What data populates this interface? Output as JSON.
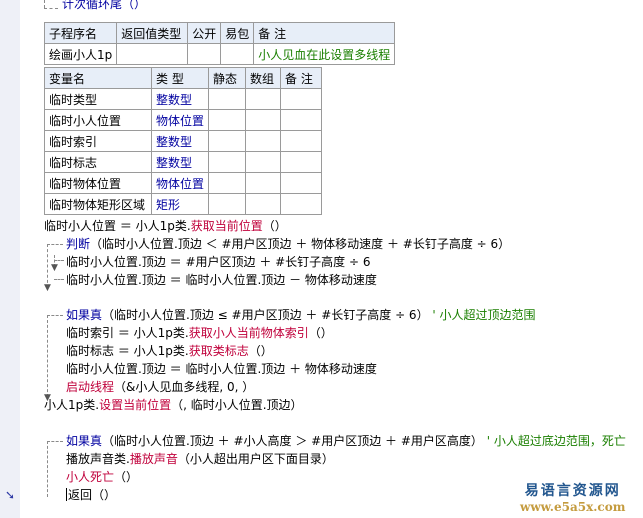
{
  "header_line": "计次循环尾（）",
  "sub_table": {
    "headers": [
      "子程序名",
      "返回值类型",
      "公开",
      "易包",
      "备 注"
    ],
    "row": [
      "绘画小人1p",
      "",
      "",
      "",
      "小人见血在此设置多线程"
    ]
  },
  "var_table": {
    "headers": [
      "变量名",
      "类 型",
      "静态",
      "数组",
      "备 注"
    ],
    "rows": [
      [
        "临时类型",
        "整数型",
        "",
        "",
        ""
      ],
      [
        "临时小人位置",
        "物体位置",
        "",
        "",
        ""
      ],
      [
        "临时索引",
        "整数型",
        "",
        "",
        ""
      ],
      [
        "临时标志",
        "整数型",
        "",
        "",
        ""
      ],
      [
        "临时物体位置",
        "物体位置",
        "",
        "",
        ""
      ],
      [
        "临时物体矩形区域",
        "矩形",
        "",
        "",
        ""
      ]
    ]
  },
  "code": {
    "l1_a": "临时小人位置 ＝ 小人1p类.",
    "l1_b": "获取当前位置",
    "l1_c": "（）",
    "l2_a": "判断",
    "l2_b": "（临时小人位置.顶边 ＜ #用户区顶边 ＋ 物体移动速度 ＋ #长钉子高度 ÷ 6）",
    "l3": "临时小人位置.顶边 ＝ #用户区顶边 ＋ #长钉子高度 ÷ 6",
    "l4": "临时小人位置.顶边 ＝ 临时小人位置.顶边 － 物体移动速度",
    "l5_a": "如果真",
    "l5_b": "（临时小人位置.顶边 ≤ #用户区顶边 ＋ #长钉子高度 ÷ 6）",
    "l5_c": "' 小人超过顶边范围",
    "l6_a": "临时索引 ＝ 小人1p类.",
    "l6_b": "获取小人当前物体索引",
    "l6_c": "（）",
    "l7_a": "临时标志 ＝ 小人1p类.",
    "l7_b": "获取类标志",
    "l7_c": "（）",
    "l8": "临时小人位置.顶边 ＝ 临时小人位置.顶边 ＋ 物体移动速度",
    "l9_a": "启动线程",
    "l9_b": "（&小人见血多线程, 0, ）",
    "l10_a": "小人1p类.",
    "l10_b": "设置当前位置",
    "l10_c": "（, 临时小人位置.顶边）",
    "l11_a": "如果真",
    "l11_b": "（临时小人位置.顶边 ＋ #小人高度 ＞ #用户区顶边 ＋ #用户区高度）",
    "l11_c": "' 小人超过底边范围，死亡",
    "l12_a": "播放声音类.",
    "l12_b": "播放声音",
    "l12_c": "（小人超出用户区下面目录）",
    "l13_a": "小人死亡",
    "l13_b": "（）",
    "l14": "返回（）"
  },
  "watermark": {
    "line1": "易语言资源网",
    "line2": "www.e5a5x.com"
  },
  "colors": {
    "keyword": "#0000a0",
    "function": "#c0003b",
    "comment": "#1a7f00",
    "gutter": "#eef0f7"
  }
}
